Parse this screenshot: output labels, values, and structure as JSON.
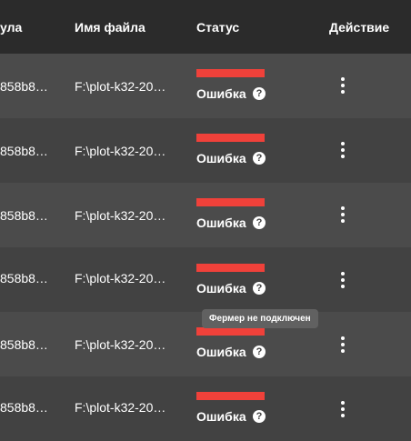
{
  "table": {
    "columns": [
      "ула",
      "Имя файла",
      "Статус",
      "Действие"
    ],
    "rows": [
      {
        "hash": "858b8…",
        "filename": "F:\\plot-k32-20…",
        "status": "Ошибка",
        "help_icon": "?"
      },
      {
        "hash": "858b8…",
        "filename": "F:\\plot-k32-20…",
        "status": "Ошибка",
        "help_icon": "?"
      },
      {
        "hash": "858b8…",
        "filename": "F:\\plot-k32-20…",
        "status": "Ошибка",
        "help_icon": "?"
      },
      {
        "hash": "858b8…",
        "filename": "F:\\plot-k32-20…",
        "status": "Ошибка",
        "help_icon": "?"
      },
      {
        "hash": "858b8…",
        "filename": "F:\\plot-k32-20…",
        "status": "Ошибка",
        "help_icon": "?"
      },
      {
        "hash": "858b8…",
        "filename": "F:\\plot-k32-20…",
        "status": "Ошибка",
        "help_icon": "?"
      }
    ]
  },
  "tooltip": {
    "text": "Фермер не подключен"
  },
  "colors": {
    "header_bg": "#2b2b2b",
    "row_alt_bg": "#4b4b4b",
    "row_bg": "#424242",
    "status_error": "#f0413a",
    "tooltip_bg": "#616161"
  },
  "icons": {
    "row_action": "more-vertical-icon",
    "status_help": "help-circle-icon"
  }
}
